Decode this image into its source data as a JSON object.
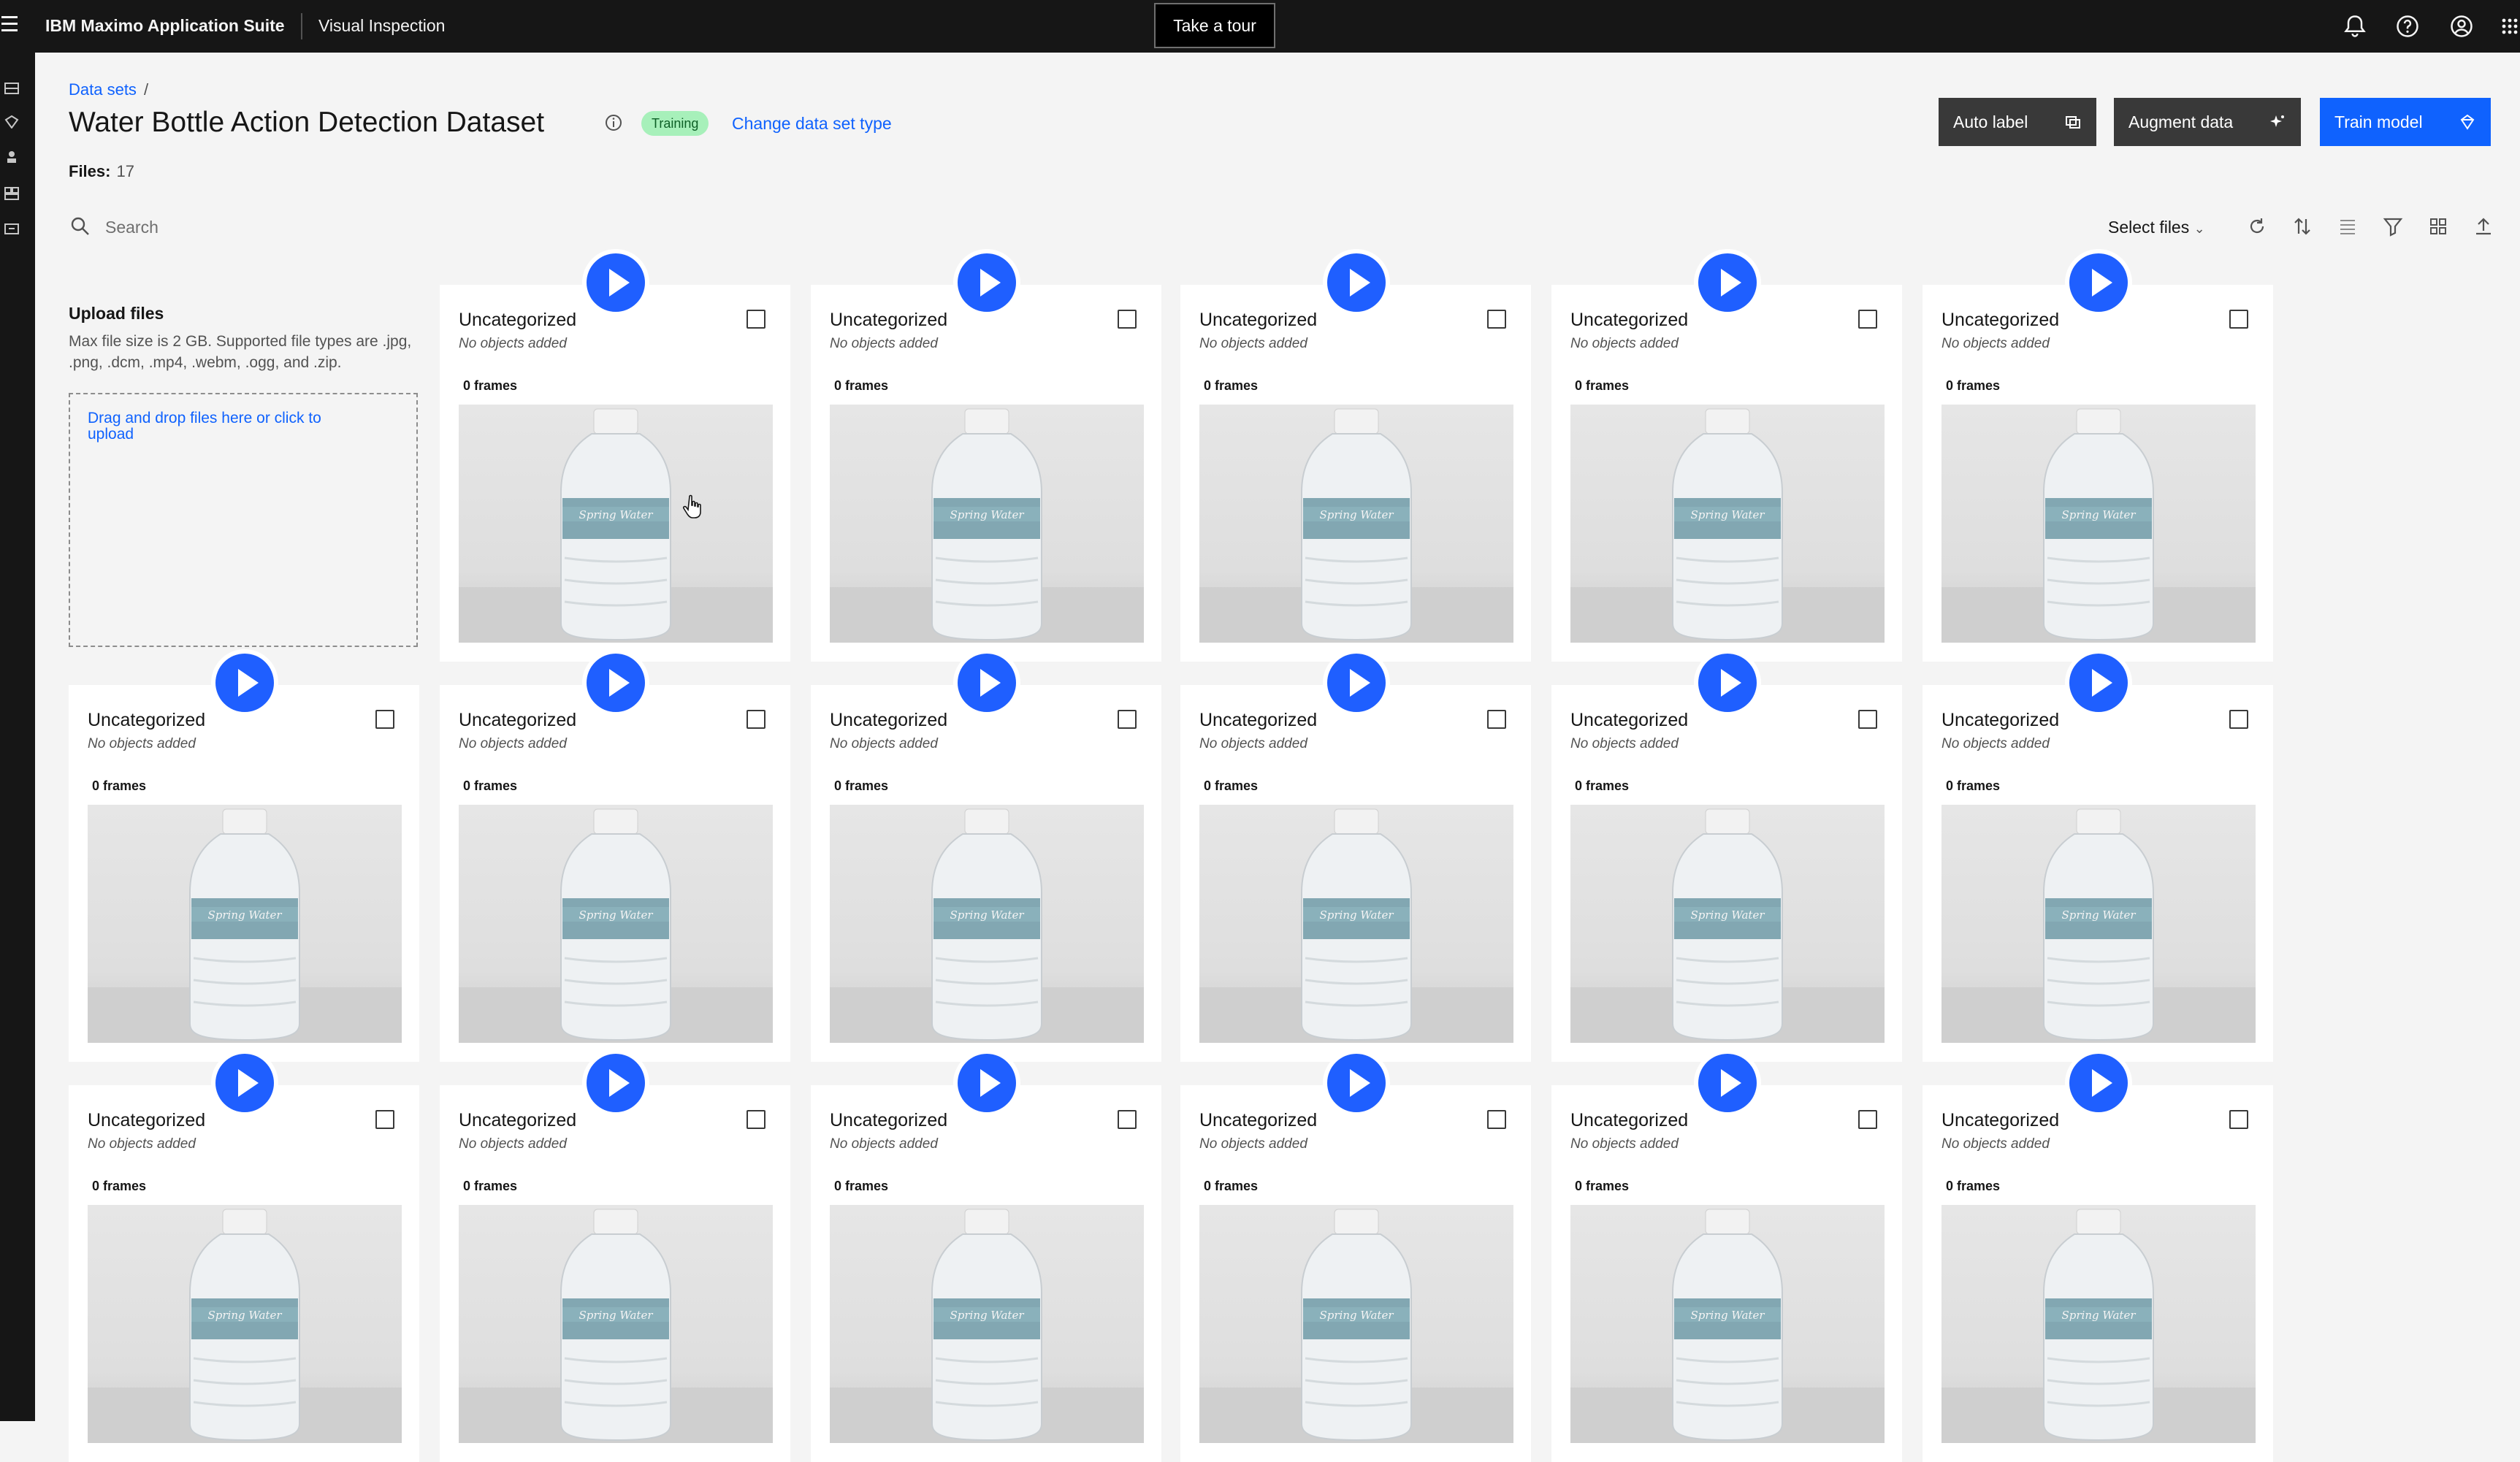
{
  "topbar": {
    "brand": "IBM Maximo Application Suite",
    "app_name": "Visual Inspection",
    "tour_label": "Take a tour",
    "icons": [
      "notification-icon",
      "help-icon",
      "user-avatar-icon",
      "app-switcher-icon"
    ]
  },
  "rail": {
    "icons": [
      "datasets-icon",
      "models-icon",
      "deploy-icon",
      "projects-icon",
      "edge-icon"
    ]
  },
  "header": {
    "breadcrumb": "Data sets",
    "breadcrumb_sep": "/",
    "title": "Water Bottle Action Detection Dataset",
    "badge": "Training",
    "change_link": "Change data set type",
    "files_label": "Files:",
    "files_count": "17"
  },
  "actions": {
    "auto_label": "Auto label",
    "augment_data": "Augment data",
    "train_model": "Train model"
  },
  "toolbar": {
    "search_placeholder": "Search",
    "select_files": "Select files",
    "icons": [
      "refresh-icon",
      "sort-icon",
      "list-view-icon",
      "filter-icon",
      "grid-view-icon",
      "upload-icon"
    ]
  },
  "upload": {
    "title": "Upload files",
    "description": "Max file size is 2 GB. Supported file types are .jpg, .png, .dcm, .mp4, .webm, .ogg, and .zip.",
    "dropzone": "Drag and drop files here or click to upload"
  },
  "cards": [
    {
      "category": "Uncategorized",
      "objects": "No objects added",
      "frames": "0 frames"
    },
    {
      "category": "Uncategorized",
      "objects": "No objects added",
      "frames": "0 frames"
    },
    {
      "category": "Uncategorized",
      "objects": "No objects added",
      "frames": "0 frames"
    },
    {
      "category": "Uncategorized",
      "objects": "No objects added",
      "frames": "0 frames"
    },
    {
      "category": "Uncategorized",
      "objects": "No objects added",
      "frames": "0 frames"
    },
    {
      "category": "Uncategorized",
      "objects": "No objects added",
      "frames": "0 frames"
    },
    {
      "category": "Uncategorized",
      "objects": "No objects added",
      "frames": "0 frames"
    },
    {
      "category": "Uncategorized",
      "objects": "No objects added",
      "frames": "0 frames"
    },
    {
      "category": "Uncategorized",
      "objects": "No objects added",
      "frames": "0 frames"
    },
    {
      "category": "Uncategorized",
      "objects": "No objects added",
      "frames": "0 frames"
    },
    {
      "category": "Uncategorized",
      "objects": "No objects added",
      "frames": "0 frames"
    },
    {
      "category": "Uncategorized",
      "objects": "No objects added",
      "frames": "0 frames"
    },
    {
      "category": "Uncategorized",
      "objects": "No objects added",
      "frames": "0 frames"
    },
    {
      "category": "Uncategorized",
      "objects": "No objects added",
      "frames": "0 frames"
    },
    {
      "category": "Uncategorized",
      "objects": "No objects added",
      "frames": "0 frames"
    },
    {
      "category": "Uncategorized",
      "objects": "No objects added",
      "frames": "0 frames"
    },
    {
      "category": "Uncategorized",
      "objects": "No objects added",
      "frames": "0 frames"
    }
  ],
  "colors": {
    "topbar_bg": "#161616",
    "link_blue": "#0f62fe",
    "badge_bg": "#a7f0ba",
    "badge_text": "#0e6027",
    "play_blue": "#1f5fff"
  }
}
